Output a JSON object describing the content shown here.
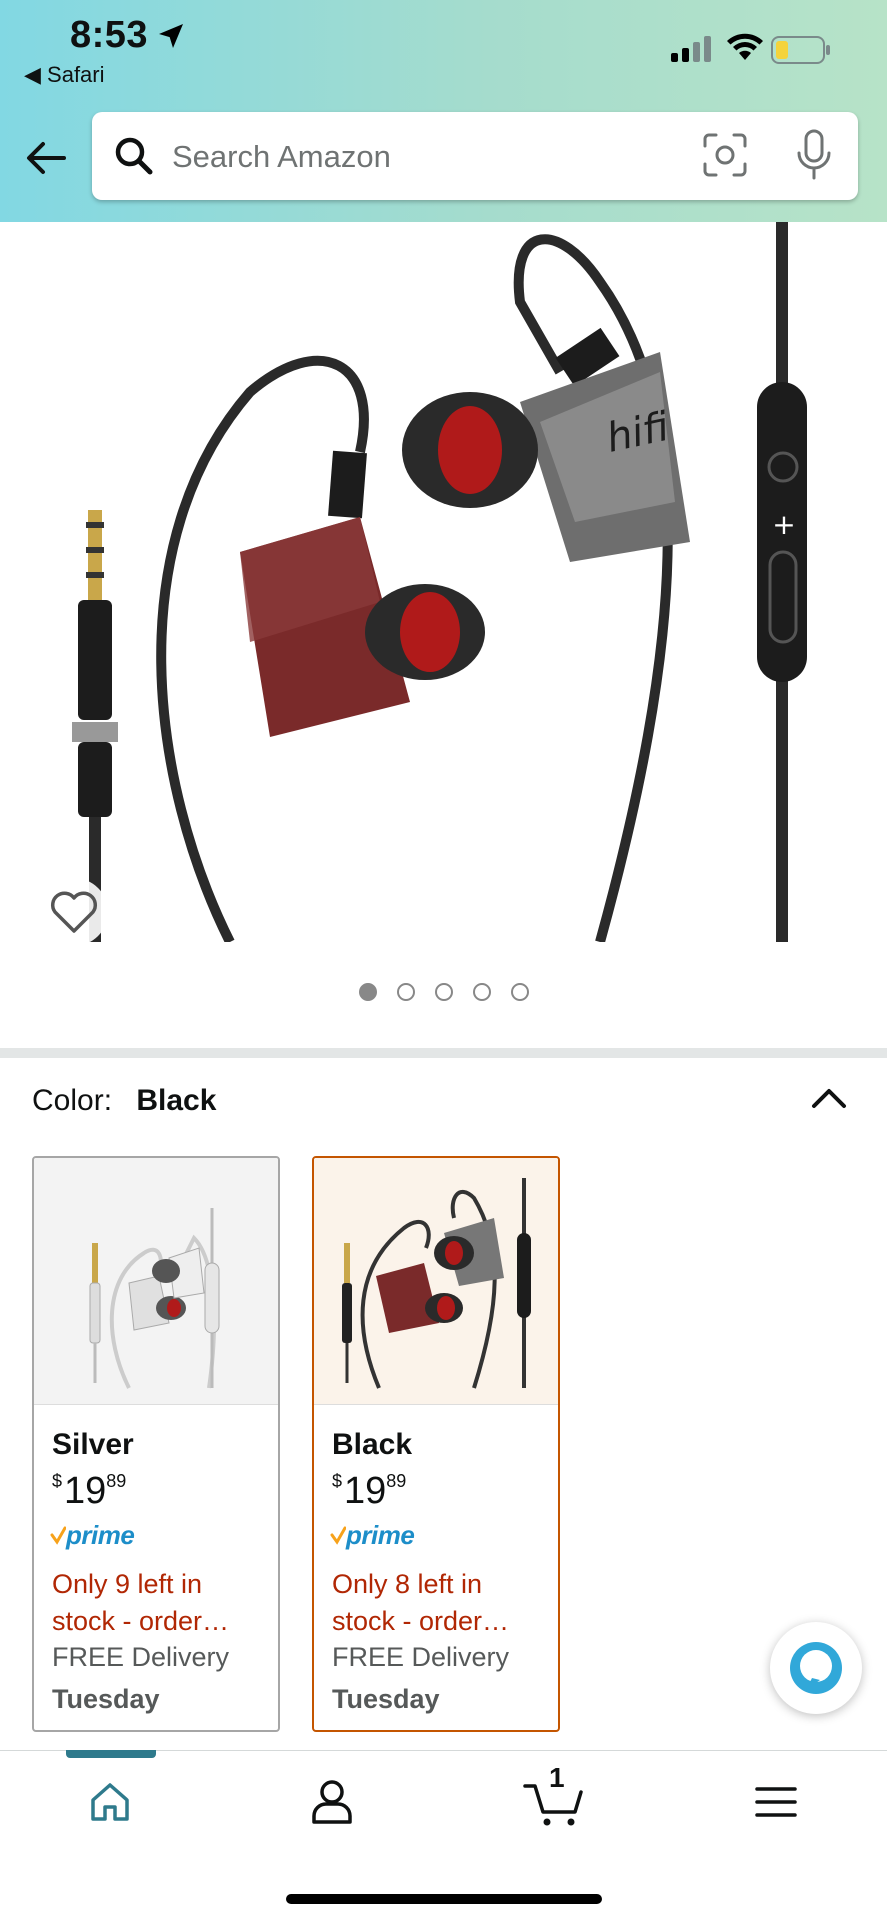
{
  "status_bar": {
    "time": "8:53",
    "back_app": "◀ Safari"
  },
  "search": {
    "placeholder": "Search Amazon"
  },
  "product": {
    "image_count": 5,
    "active_image": 1
  },
  "variation": {
    "label": "Color:",
    "selected": "Black"
  },
  "swatches": [
    {
      "name": "Silver",
      "price_currency": "$",
      "price_whole": "19",
      "price_fraction": "89",
      "prime": "prime",
      "stock": "Only 9 left in stock - order…",
      "delivery": "FREE Delivery",
      "day": "Tuesday"
    },
    {
      "name": "Black",
      "price_currency": "$",
      "price_whole": "19",
      "price_fraction": "89",
      "prime": "prime",
      "stock": "Only 8 left in stock - order…",
      "delivery": "FREE Delivery",
      "day": "Tuesday"
    }
  ],
  "bottom_nav": {
    "cart_count": "1",
    "items": [
      "home-icon",
      "account-icon",
      "cart-icon",
      "menu-icon"
    ]
  },
  "colors": {
    "accent_teal": "#2e7a8c",
    "stock_red": "#b12704",
    "selected_border": "#c45500",
    "prime_blue": "#1d8ec9"
  }
}
